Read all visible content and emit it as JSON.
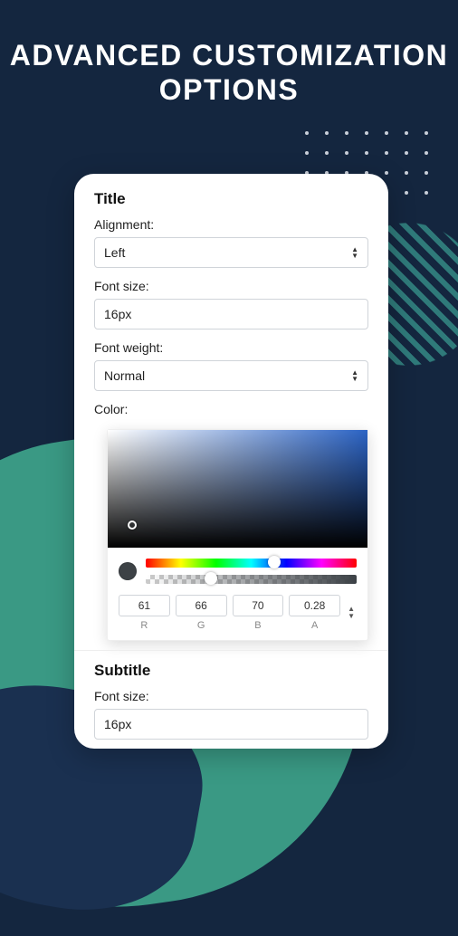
{
  "headline": "ADVANCED CUSTOMIZATION OPTIONS",
  "title": {
    "heading": "Title",
    "alignment": {
      "label": "Alignment:",
      "value": "Left"
    },
    "fontSize": {
      "label": "Font size:",
      "value": "16px"
    },
    "fontWeight": {
      "label": "Font weight:",
      "value": "Normal"
    },
    "color": {
      "label": "Color:",
      "r": "61",
      "g": "66",
      "b": "70",
      "a": "0.28",
      "channels": {
        "r": "R",
        "g": "G",
        "b": "B",
        "a": "A"
      },
      "huePercent": 58,
      "alphaPercent": 28
    }
  },
  "subtitle": {
    "heading": "Subtitle",
    "fontSize": {
      "label": "Font size:",
      "value": "16px"
    }
  }
}
